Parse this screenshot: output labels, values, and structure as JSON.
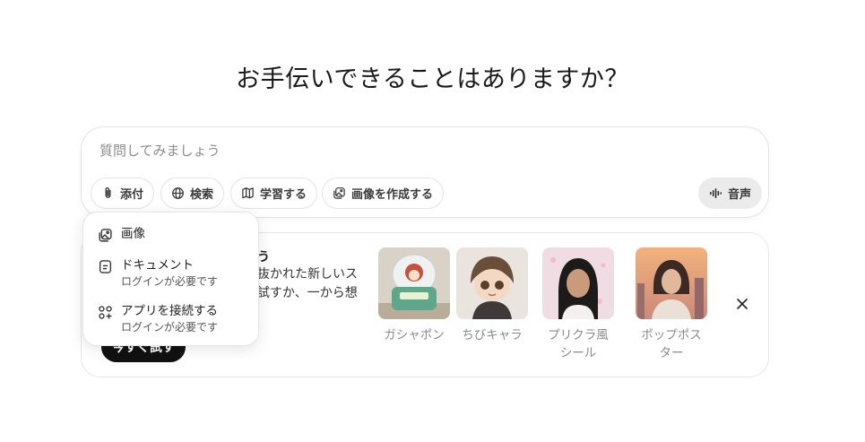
{
  "headline": "お手伝いできることはありますか？",
  "composer": {
    "placeholder": "質問してみましょう",
    "tools": [
      {
        "label": "添付",
        "icon": "paperclip-icon"
      },
      {
        "label": "検索",
        "icon": "globe-icon"
      },
      {
        "label": "学習する",
        "icon": "book-icon"
      },
      {
        "label": "画像を作成する",
        "icon": "image-create-icon"
      }
    ],
    "voice_label": "音声"
  },
  "attach_menu": {
    "items": [
      {
        "label": "画像",
        "sub": "",
        "icon": "image-icon"
      },
      {
        "label": "ドキュメント",
        "sub": "ログインが必要です",
        "icon": "document-icon"
      },
      {
        "label": "アプリを接続する",
        "sub": "ログインが必要です",
        "icon": "apps-icon"
      }
    ]
  },
  "suggestion": {
    "title_fragment": "う",
    "body_line1": "抜かれた新しいス",
    "body_line2": "試すか、一から想",
    "try_label": "今すぐ試す",
    "styles": [
      {
        "label": "ガシャポン"
      },
      {
        "label": "ちびキャラ"
      },
      {
        "label": "プリクラ風シール"
      },
      {
        "label": "ポップポスター"
      }
    ]
  },
  "colors": {
    "accent_dark": "#111111",
    "border": "#e3e3e3",
    "muted_text": "#8a8a8a"
  }
}
